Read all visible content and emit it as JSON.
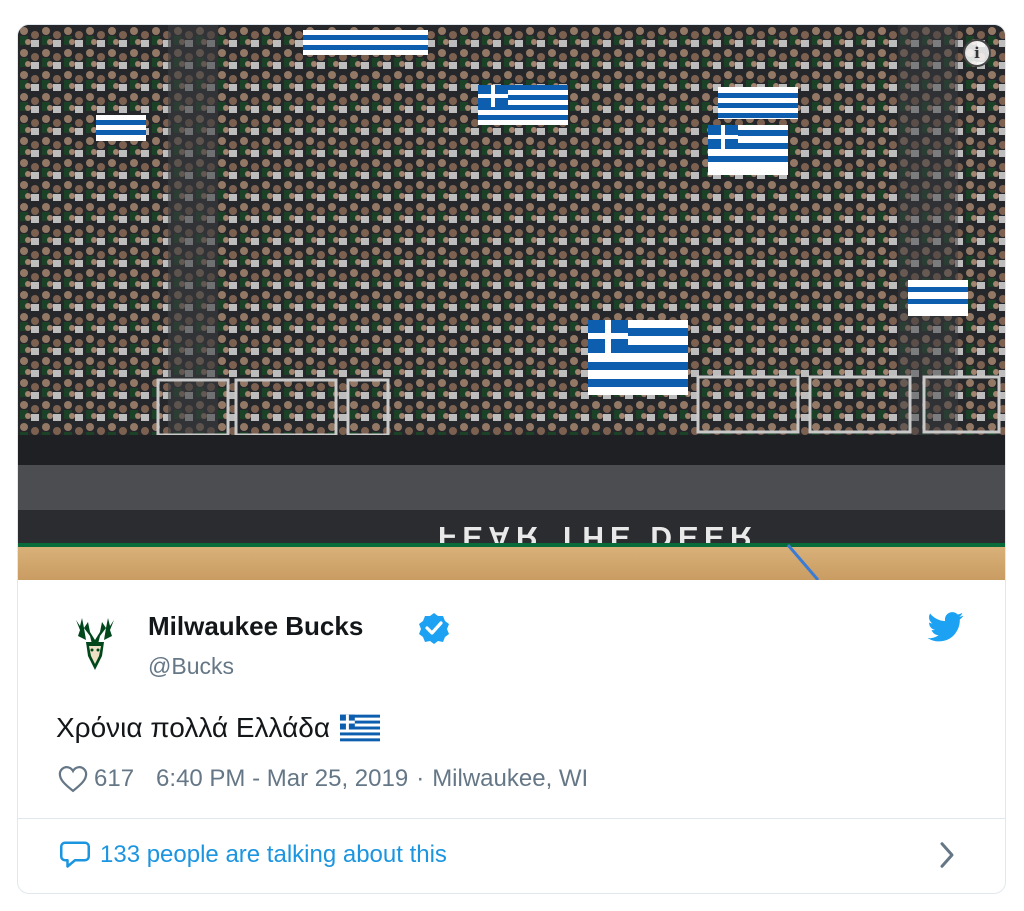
{
  "photo": {
    "alt": "",
    "court_lettering": "FEAR THE DEER"
  },
  "account": {
    "display_name": "Milwaukee Bucks",
    "handle": "@Bucks",
    "verified": true
  },
  "tweet": {
    "text": "Χρόνια πολλά Ελλάδα",
    "emoji": "flag-greece-icon"
  },
  "meta": {
    "likes": "617",
    "time": "6:40 PM - Mar 25, 2019",
    "separator": "·",
    "location": "Milwaukee, WI"
  },
  "footer": {
    "talking_text": "133 people are talking about this"
  },
  "colors": {
    "brand_blue": "#1da1f2",
    "link_blue": "#1b95e0",
    "muted": "#657786",
    "bucks_green": "#00471b",
    "greek_blue": "#0d5eaf"
  },
  "icons": [
    "info-icon",
    "bucks-logo-icon",
    "verified-badge-icon",
    "twitter-bird-icon",
    "heart-icon",
    "speech-bubble-icon",
    "chevron-right-icon"
  ]
}
